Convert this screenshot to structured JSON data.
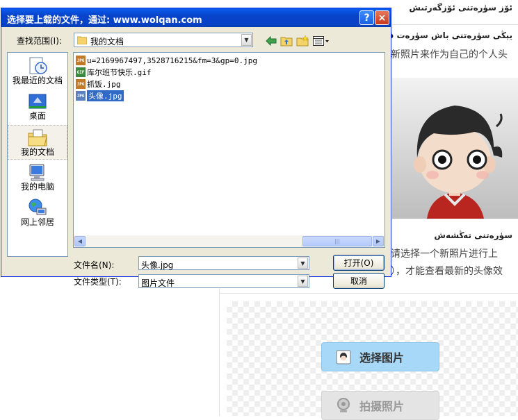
{
  "background": {
    "header_title": "ئۆز سۈرەتنى ئۆزگەرتىش",
    "section1": {
      "title": "يېڭى سۈرەتنى باش سۈرەت قىلىش",
      "text": "新照片来作为自己的个人头"
    },
    "section2": {
      "title": "سۈرەتنى تەڭشەش",
      "text1": "请选择一个新照片进行上",
      "text2": "），才能查看最新的头像效"
    },
    "buttons": {
      "select_image": "选择图片",
      "take_photo": "拍摄照片"
    }
  },
  "dialog": {
    "title": "选择要上载的文件，通过: www.wolqan.com",
    "help_icon": "?",
    "close_icon": "×",
    "look_in_label": "查找范围(I):",
    "look_in_value": "我的文档",
    "places": [
      {
        "label": "我最近的文档",
        "icon": "recent-docs-icon"
      },
      {
        "label": "桌面",
        "icon": "desktop-icon"
      },
      {
        "label": "我的文档",
        "icon": "my-documents-icon",
        "selected": true
      },
      {
        "label": "我的电脑",
        "icon": "my-computer-icon"
      },
      {
        "label": "网上邻居",
        "icon": "network-places-icon"
      }
    ],
    "files": [
      {
        "name": "u=2169967497,3528716215&fm=3&gp=0.jpg",
        "type": "JPG"
      },
      {
        "name": "库尔班节快乐.gif",
        "type": "GIF"
      },
      {
        "name": "抓饭.jpg",
        "type": "JPG"
      },
      {
        "name": "头像.jpg",
        "type": "JPG",
        "selected": true
      }
    ],
    "filename_label": "文件名(N):",
    "filename_value": "头像.jpg",
    "filetype_label": "文件类型(T):",
    "filetype_value": "图片文件",
    "open_button": "打开(O)",
    "cancel_button": "取消"
  }
}
